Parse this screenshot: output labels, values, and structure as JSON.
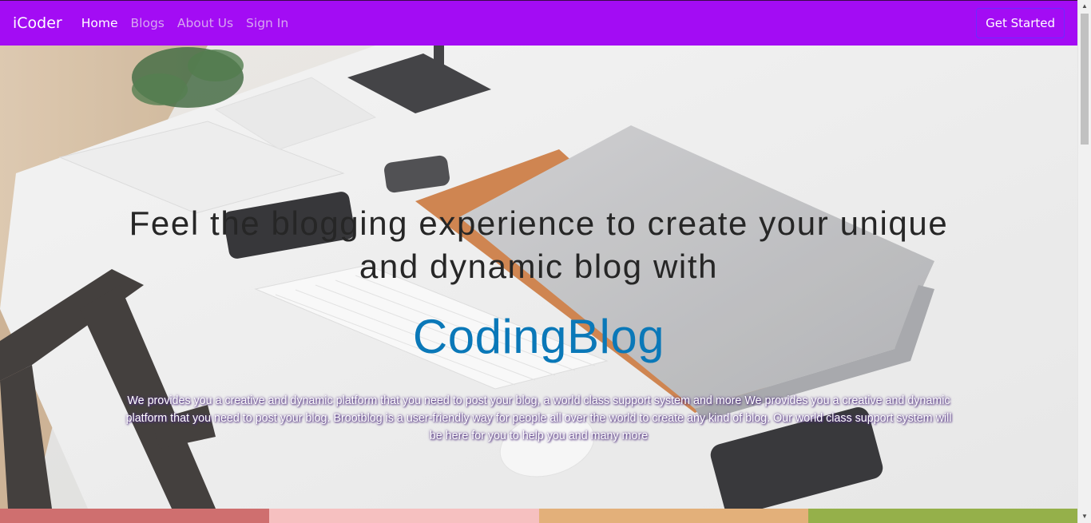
{
  "navbar": {
    "brand": "iCoder",
    "background": "#a30cf4",
    "active_color": "#ffffff",
    "muted_color": "#d7a6f0",
    "links": [
      {
        "label": "Home",
        "active": true
      },
      {
        "label": "Blogs",
        "active": false
      },
      {
        "label": "About Us",
        "active": false
      },
      {
        "label": "Sign In",
        "active": false
      }
    ],
    "cta_label": "Get Started"
  },
  "hero": {
    "headline": "Feel the blogging experience to create your unique and dynamic blog with",
    "brand_name": "CodingBlog",
    "brand_color": "#0a78b8",
    "tagline": "We provides you a creative and dynamic platform that you need to post your blog, a world class support system and more We provides you a creative and dynamic platform that you need to post your blog. Brootblog is a user-friendly way for people all over the world to create any kind of blog. Our world class support system will be here for you to help you and many more",
    "background_icon": "desk-workspace-photo"
  },
  "strip_colors": [
    "#cf6f6f",
    "#f6c0c0",
    "#e3b07a",
    "#95b04a"
  ],
  "scrollbar": {
    "up_icon": "scroll-up-arrow-icon",
    "down_icon": "scroll-down-arrow-icon"
  }
}
